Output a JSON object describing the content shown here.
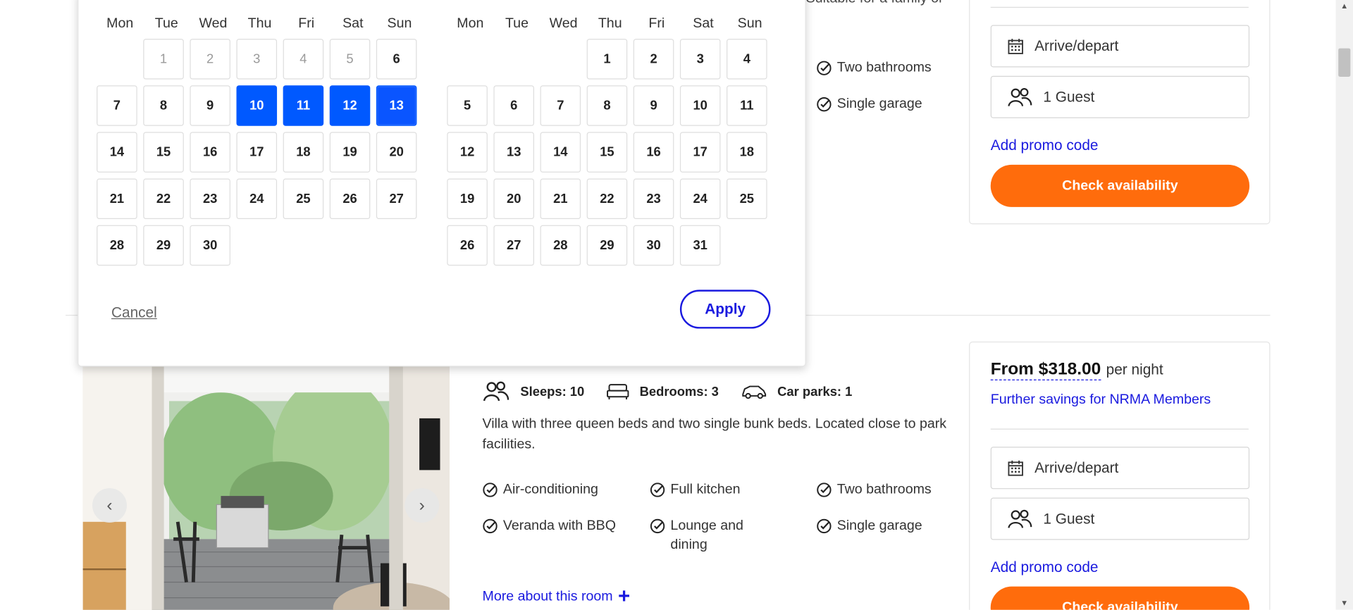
{
  "colors": {
    "accent_blue": "#1a1adf",
    "selected_day": "#0059ff",
    "cta_orange": "#ff6c0c"
  },
  "listing_top": {
    "description_fragment": "Suitable for a family or",
    "amenities": [
      "Two bathrooms",
      "Single garage"
    ]
  },
  "booking_top": {
    "arrive_depart": "Arrive/depart",
    "guests": "1 Guest",
    "promo": "Add promo code",
    "cta": "Check availability"
  },
  "room": {
    "stats": [
      {
        "icon": "people-icon",
        "label": "Sleeps: 10"
      },
      {
        "icon": "bed-icon",
        "label": "Bedrooms: 3"
      },
      {
        "icon": "car-icon",
        "label": "Car parks: 1"
      }
    ],
    "description": "Villa with three queen beds and two single bunk beds. Located close to park facilities.",
    "amenities": [
      "Air-conditioning",
      "Full kitchen",
      "Two bathrooms",
      "Veranda with BBQ",
      "Lounge and dining",
      "Single garage"
    ],
    "more_link": "More about this room",
    "more_plus": "+"
  },
  "booking_bottom": {
    "price": "From $318.00",
    "per_night": "per night",
    "savings": "Further savings for NRMA Members",
    "arrive_depart": "Arrive/depart",
    "guests": "1 Guest",
    "promo": "Add promo code",
    "cta": "Check availability"
  },
  "calendar": {
    "weekdays": [
      "Mon",
      "Tue",
      "Wed",
      "Thu",
      "Fri",
      "Sat",
      "Sun"
    ],
    "months": [
      {
        "offset": 1,
        "days": 30,
        "disabled_until": 5,
        "selected": [
          10,
          11,
          12,
          13
        ]
      },
      {
        "offset": 3,
        "days": 31,
        "disabled_until": 0,
        "selected": []
      }
    ],
    "cancel": "Cancel",
    "apply": "Apply"
  },
  "carousel": {
    "prev": "‹",
    "next": "›"
  }
}
